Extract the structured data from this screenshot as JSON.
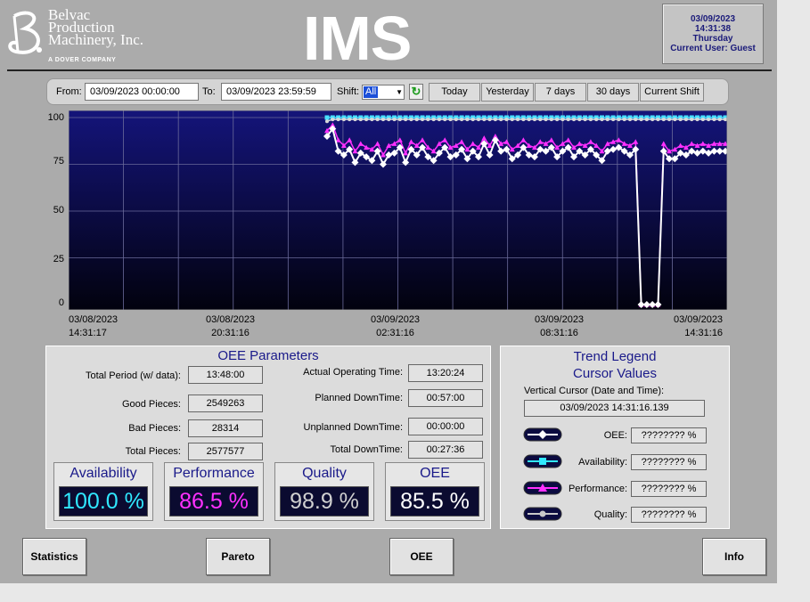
{
  "header": {
    "logo_lines": [
      "Belvac",
      "Production",
      "Machinery, Inc."
    ],
    "logo_tagline": "A DOVER COMPANY",
    "app_title": "IMS",
    "date": "03/09/2023",
    "time": "14:31:38",
    "weekday": "Thursday",
    "current_user": "Current User: Guest"
  },
  "toolbar": {
    "from_label": "From:",
    "from_value": "03/09/2023 00:00:00",
    "to_label": "To:",
    "to_value": "03/09/2023 23:59:59",
    "shift_label": "Shift:",
    "shift_value": "All",
    "buttons": [
      "Today",
      "Yesterday",
      "7 days",
      "30 days",
      "Current Shift"
    ]
  },
  "chart_data": {
    "type": "line",
    "ylim": [
      0,
      100
    ],
    "yticks": [
      "100",
      "75",
      "50",
      "25",
      "0"
    ],
    "xticks": [
      {
        "date": "03/08/2023",
        "time": "14:31:17"
      },
      {
        "date": "03/08/2023",
        "time": "20:31:16"
      },
      {
        "date": "03/09/2023",
        "time": "02:31:16"
      },
      {
        "date": "03/09/2023",
        "time": "08:31:16"
      },
      {
        "date": "03/09/2023",
        "time": "14:31:16"
      }
    ],
    "grid": true,
    "series": [
      {
        "name": "Availability",
        "color": "#48e0ff",
        "values": [
          100,
          100,
          100,
          100,
          100,
          100,
          100,
          100,
          100,
          100,
          100,
          100,
          100,
          100,
          100,
          100,
          100,
          100,
          100,
          100,
          100,
          100,
          100,
          100,
          100,
          100,
          100,
          100,
          100,
          100,
          100,
          100,
          100,
          100,
          100,
          100,
          100,
          100,
          100,
          100,
          100,
          100,
          100,
          100,
          100,
          100,
          100,
          100,
          100,
          100,
          100,
          100,
          100,
          100,
          100,
          100,
          100,
          100,
          100,
          100,
          100,
          100,
          100,
          100,
          100,
          100,
          100,
          100,
          100,
          100,
          100,
          100
        ]
      },
      {
        "name": "Performance",
        "color": "#ff30ff",
        "values": [
          93,
          96,
          88,
          85,
          88,
          82,
          86,
          84,
          83,
          86,
          80,
          85,
          86,
          88,
          81,
          87,
          85,
          88,
          84,
          82,
          86,
          88,
          84,
          85,
          87,
          83,
          86,
          84,
          89,
          85,
          90,
          86,
          87,
          83,
          85,
          88,
          85,
          84,
          87,
          86,
          88,
          84,
          86,
          88,
          84,
          86,
          85,
          87,
          85,
          82,
          86,
          87,
          88,
          86,
          85,
          87,
          0,
          0,
          0,
          0,
          86,
          82,
          83,
          85,
          84,
          86,
          85,
          86,
          85,
          86,
          86,
          86
        ]
      },
      {
        "name": "Quality",
        "color": "#d8d8d8",
        "values": [
          98,
          99,
          99,
          99,
          99,
          99,
          99,
          99,
          99,
          99,
          99,
          99,
          99,
          99,
          99,
          99,
          99,
          99,
          99,
          99,
          99,
          99,
          99,
          99,
          99,
          99,
          99,
          99,
          99,
          99,
          99,
          99,
          99,
          99,
          99,
          99,
          99,
          99,
          99,
          99,
          99,
          99,
          99,
          99,
          99,
          99,
          99,
          99,
          99,
          99,
          99,
          99,
          99,
          99,
          99,
          99,
          99,
          99,
          99,
          99,
          99,
          99,
          99,
          99,
          99,
          99,
          99,
          99,
          99,
          99,
          99,
          99
        ]
      },
      {
        "name": "OEE",
        "color": "#ffffff",
        "values": [
          90,
          94,
          82,
          80,
          83,
          76,
          81,
          79,
          77,
          82,
          75,
          80,
          81,
          84,
          76,
          83,
          80,
          84,
          79,
          77,
          81,
          84,
          79,
          80,
          83,
          78,
          82,
          79,
          86,
          80,
          88,
          82,
          83,
          78,
          80,
          84,
          80,
          79,
          83,
          82,
          84,
          79,
          82,
          84,
          79,
          82,
          80,
          83,
          80,
          77,
          82,
          83,
          84,
          82,
          80,
          83,
          0,
          0,
          0,
          0,
          82,
          78,
          78,
          81,
          80,
          82,
          81,
          82,
          81,
          82,
          82,
          82
        ]
      }
    ]
  },
  "oee_params": {
    "title": "OEE Parameters",
    "total_period_label": "Total Period (w/ data):",
    "total_period": "13:48:00",
    "good_pieces_label": "Good Pieces:",
    "good_pieces": "2549263",
    "bad_pieces_label": "Bad Pieces:",
    "bad_pieces": "28314",
    "total_pieces_label": "Total Pieces:",
    "total_pieces": "2577577",
    "actual_op_label": "Actual Operating Time:",
    "actual_op": "13:20:24",
    "planned_dt_label": "Planned DownTime:",
    "planned_dt": "00:57:00",
    "unplanned_dt_label": "Unplanned DownTime:",
    "unplanned_dt": "00:00:00",
    "total_dt_label": "Total DownTime:",
    "total_dt": "00:27:36"
  },
  "kpis": [
    {
      "title": "Availability",
      "value": "100.0 %",
      "color": "#30e8ff"
    },
    {
      "title": "Performance",
      "value": "86.5 %",
      "color": "#ff30ff"
    },
    {
      "title": "Quality",
      "value": "98.9 %",
      "color": "#d0d0d0"
    },
    {
      "title": "OEE",
      "value": "85.5 %",
      "color": "#ffffff"
    }
  ],
  "legend": {
    "title_line1": "Trend Legend",
    "title_line2": "Cursor Values",
    "cursor_label": "Vertical Cursor (Date and Time):",
    "cursor_value": "03/09/2023 14:31:16.139",
    "items": [
      {
        "label": "OEE:",
        "value": "???????? %",
        "icon": "oee-trend-icon"
      },
      {
        "label": "Availability:",
        "value": "???????? %",
        "icon": "availability-trend-icon"
      },
      {
        "label": "Performance:",
        "value": "???????? %",
        "icon": "performance-trend-icon"
      },
      {
        "label": "Quality:",
        "value": "???????? %",
        "icon": "quality-trend-icon"
      }
    ]
  },
  "nav": {
    "statistics": "Statistics",
    "pareto": "Pareto",
    "oee": "OEE",
    "info": "Info"
  }
}
